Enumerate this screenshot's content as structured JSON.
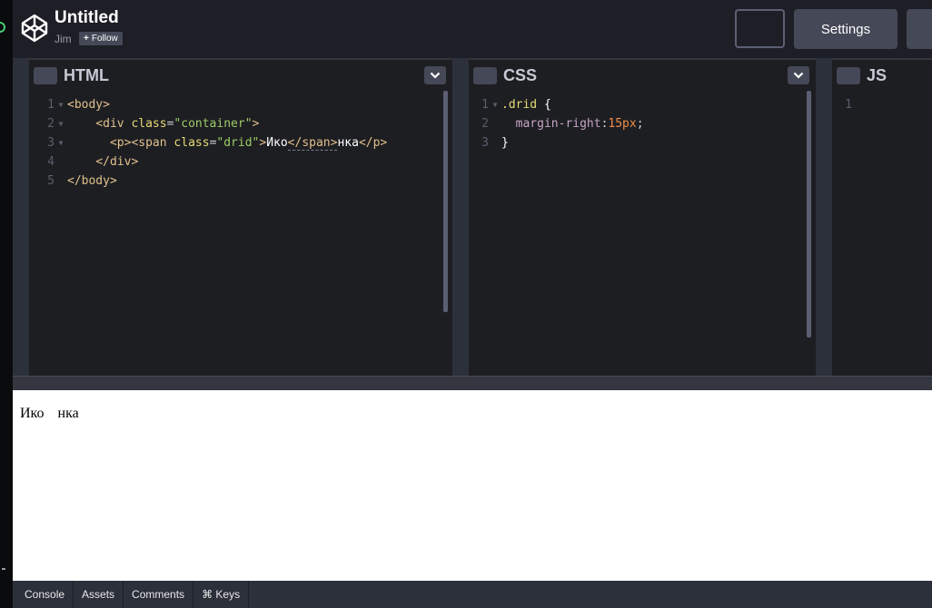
{
  "header": {
    "title": "Untitled",
    "author": "Jim",
    "follow_label": "Follow",
    "follow_icon": "plus-icon",
    "logo": "codepen-logo",
    "settings_label": "Settings"
  },
  "editors": {
    "html": {
      "label": "HTML",
      "line_numbers": [
        "1",
        "2",
        "3",
        "4",
        "5"
      ]
    },
    "css": {
      "label": "CSS",
      "line_numbers": [
        "1",
        "2",
        "3"
      ]
    },
    "js": {
      "label": "JS",
      "line_numbers": [
        "1"
      ]
    }
  },
  "code": {
    "html": {
      "l1_tag": "<body>",
      "l2_open": "<div ",
      "l2_attr": "class",
      "l2_eq": "=",
      "l2_val": "\"container\"",
      "l2_close": ">",
      "l3_p": "<p>",
      "l3_span_open": "<span ",
      "l3_attr": "class",
      "l3_eq": "=",
      "l3_val": "\"drid\"",
      "l3_gt": ">",
      "l3_text1": "Ико",
      "l3_span_close": "</span>",
      "l3_text2": "нка",
      "l3_p_close": "</p>",
      "l4_tag": "</div>",
      "l5_tag": "</body>"
    },
    "css": {
      "l1_selector": ".drid",
      "l1_brace": "{",
      "l2_prop": "margin-right",
      "l2_colon": ":",
      "l2_value": "15px",
      "l2_semi": ";",
      "l3_brace": "}"
    }
  },
  "preview": {
    "span_text": "Ико",
    "rest_text": "нка"
  },
  "footer": {
    "buttons": [
      "Console",
      "Assets",
      "Comments",
      "⌘ Keys"
    ]
  },
  "colors": {
    "accent_green": "#47cf73",
    "header_bg": "#1e1f26",
    "button_bg": "#444857",
    "editor_bg": "#1d1e22"
  }
}
